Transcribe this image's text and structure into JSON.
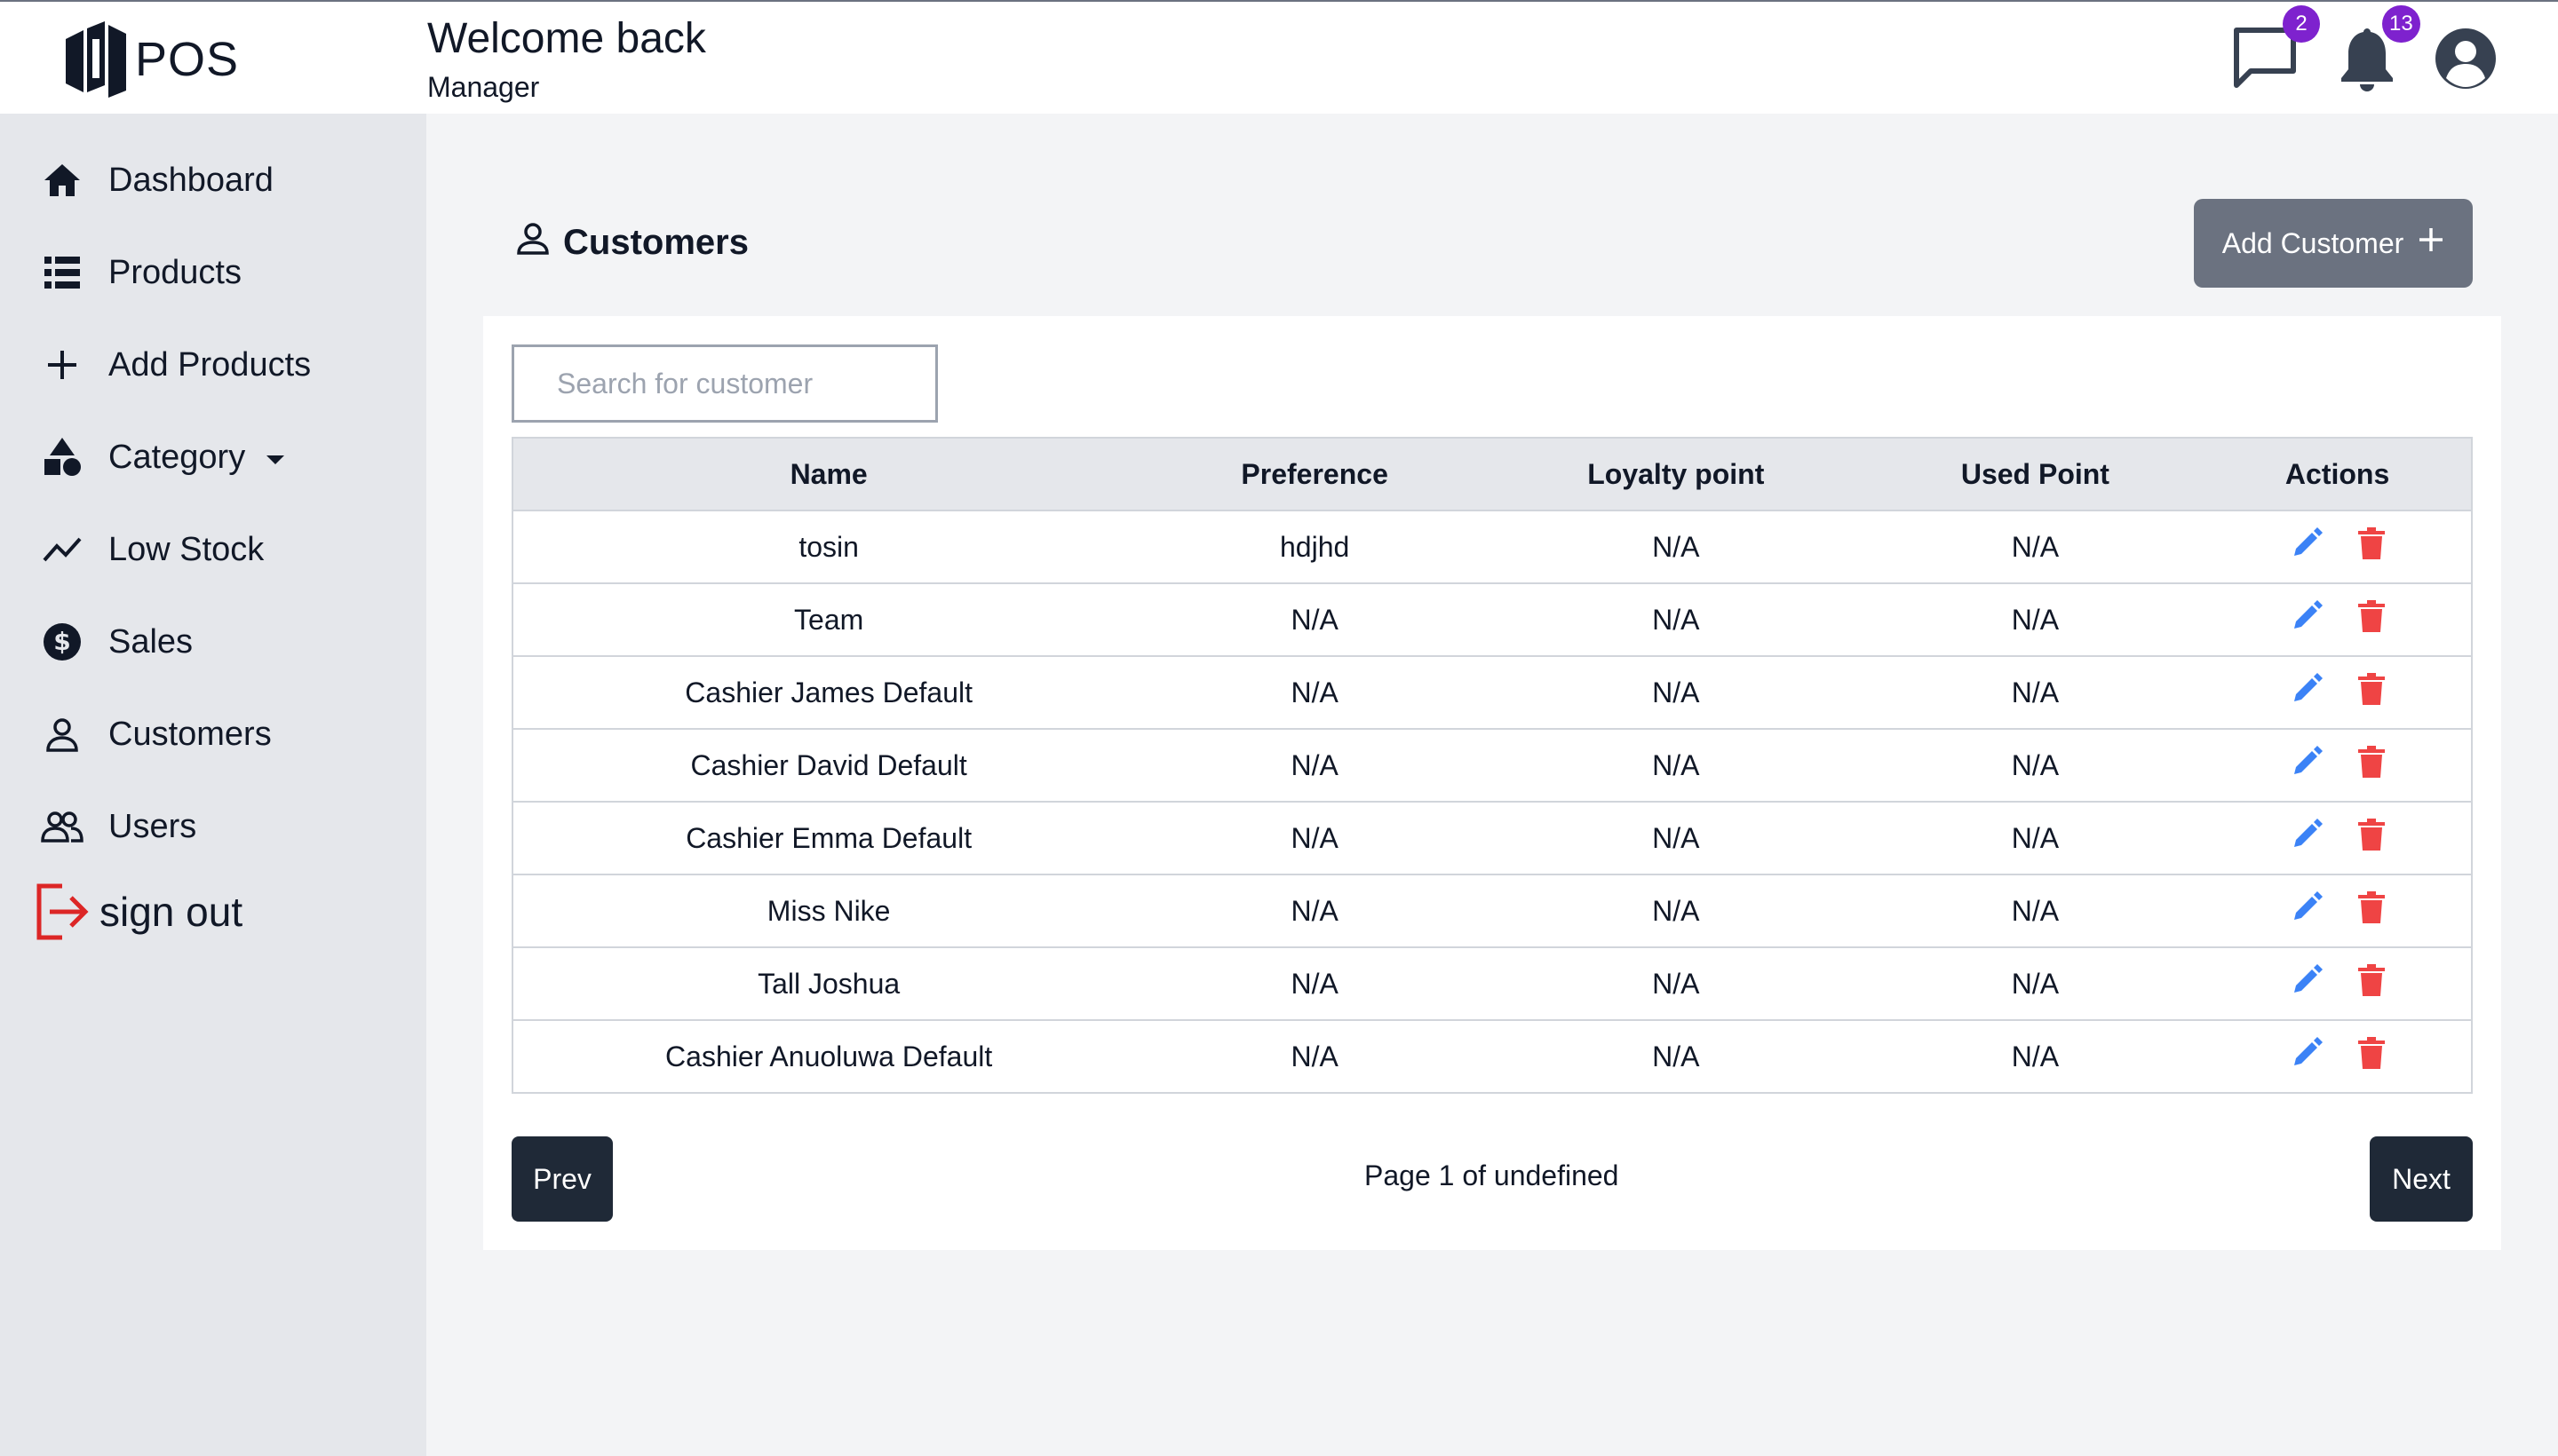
{
  "app": {
    "logo_text": "POS"
  },
  "header": {
    "title": "Welcome back",
    "subtitle": "Manager",
    "messages_count": "2",
    "notifications_count": "13"
  },
  "sidebar": {
    "items": [
      {
        "label": "Dashboard",
        "icon": "home-icon"
      },
      {
        "label": "Products",
        "icon": "list-icon"
      },
      {
        "label": "Add Products",
        "icon": "plus-icon"
      },
      {
        "label": "Category",
        "icon": "shapes-icon"
      },
      {
        "label": "Low Stock",
        "icon": "trend-icon"
      },
      {
        "label": "Sales",
        "icon": "dollar-icon"
      },
      {
        "label": "Customers",
        "icon": "user-icon"
      },
      {
        "label": "Users",
        "icon": "users-icon"
      },
      {
        "label": "sign out",
        "icon": "sign-out-icon"
      }
    ]
  },
  "page": {
    "title": "Customers",
    "add_button": "Add Customer",
    "search_placeholder": "Search for customer"
  },
  "table": {
    "columns": [
      "Name",
      "Preference",
      "Loyalty point",
      "Used Point",
      "Actions"
    ],
    "rows": [
      {
        "name": "tosin",
        "preference": "hdjhd",
        "loyalty": "N/A",
        "used": "N/A"
      },
      {
        "name": "Team",
        "preference": "N/A",
        "loyalty": "N/A",
        "used": "N/A"
      },
      {
        "name": "Cashier James Default",
        "preference": "N/A",
        "loyalty": "N/A",
        "used": "N/A"
      },
      {
        "name": "Cashier David Default",
        "preference": "N/A",
        "loyalty": "N/A",
        "used": "N/A"
      },
      {
        "name": "Cashier Emma Default",
        "preference": "N/A",
        "loyalty": "N/A",
        "used": "N/A"
      },
      {
        "name": "Miss Nike",
        "preference": "N/A",
        "loyalty": "N/A",
        "used": "N/A"
      },
      {
        "name": "Tall Joshua",
        "preference": "N/A",
        "loyalty": "N/A",
        "used": "N/A"
      },
      {
        "name": "Cashier Anuoluwa Default",
        "preference": "N/A",
        "loyalty": "N/A",
        "used": "N/A"
      }
    ]
  },
  "pagination": {
    "prev": "Prev",
    "next": "Next",
    "status": "Page 1 of undefined"
  },
  "colors": {
    "edit": "#3b82f6",
    "delete": "#ef4444",
    "badge": "#7e22ce",
    "sign_out": "#dc2626"
  }
}
